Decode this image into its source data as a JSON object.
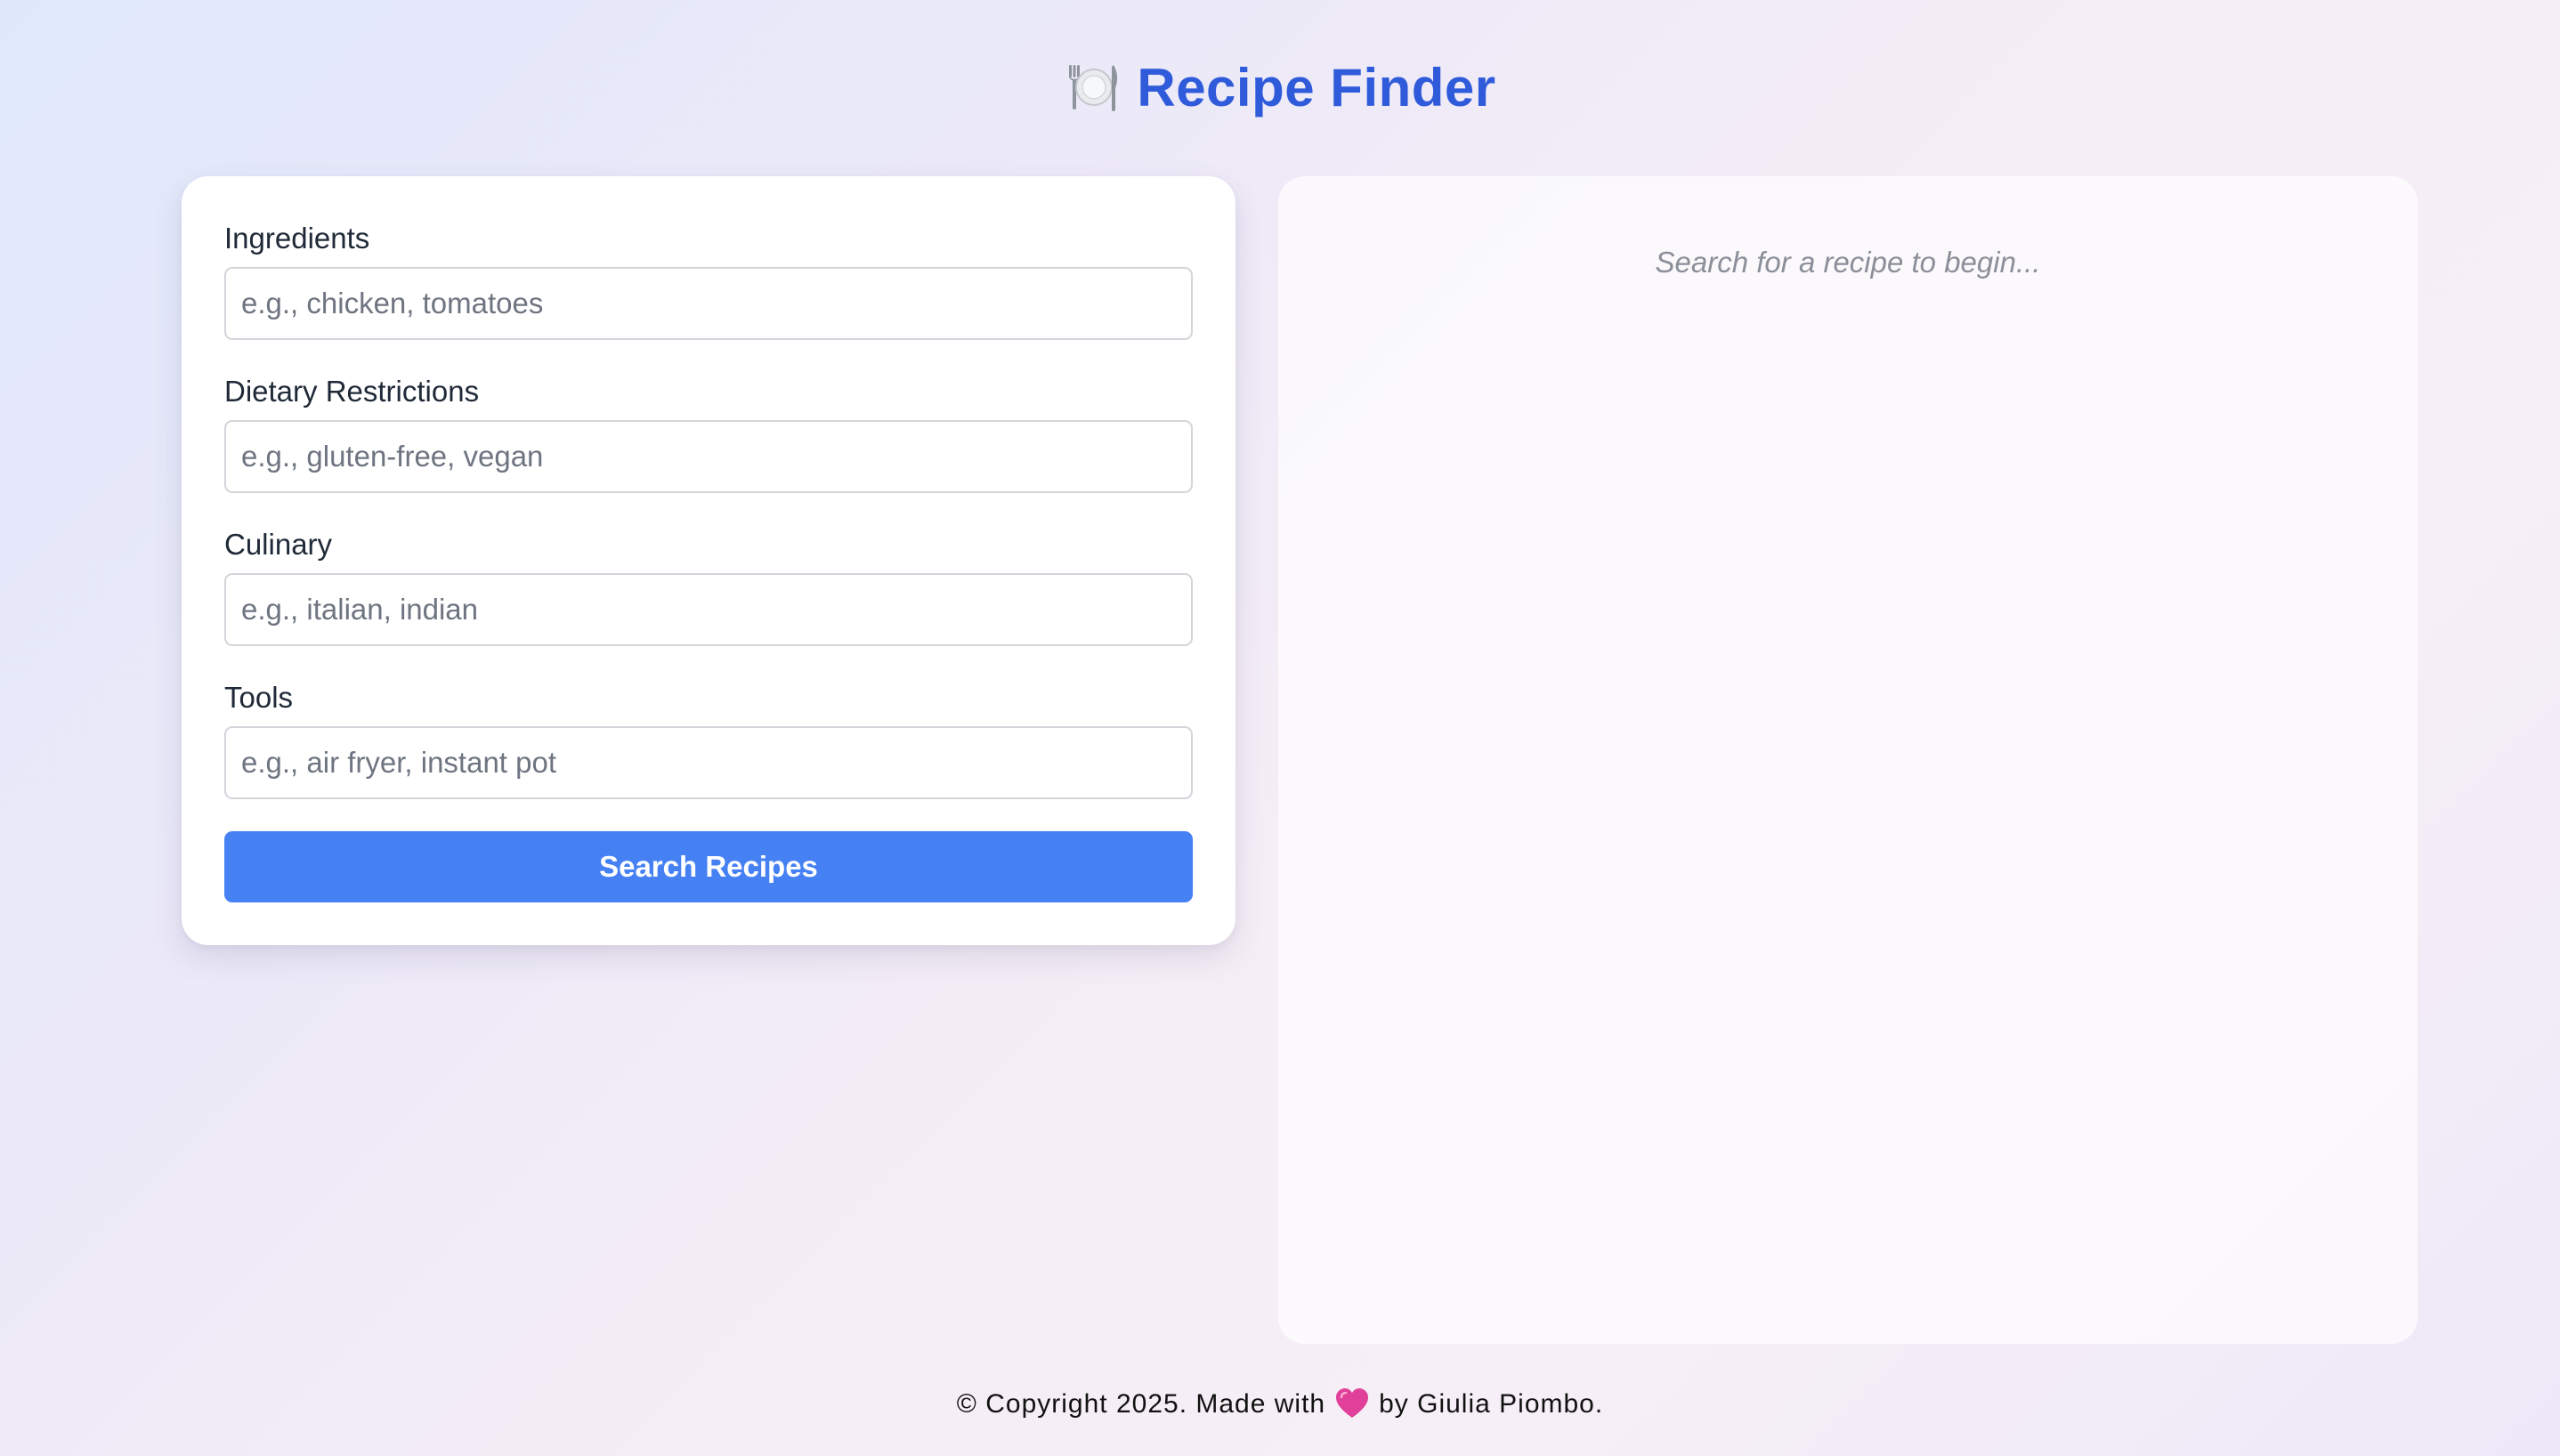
{
  "header": {
    "icon": "plate-with-cutlery-icon",
    "title": "Recipe Finder"
  },
  "form": {
    "fields": [
      {
        "label": "Ingredients",
        "placeholder": "e.g., chicken, tomatoes",
        "value": ""
      },
      {
        "label": "Dietary Restrictions",
        "placeholder": "e.g., gluten-free, vegan",
        "value": ""
      },
      {
        "label": "Culinary",
        "placeholder": "e.g., italian, indian",
        "value": ""
      },
      {
        "label": "Tools",
        "placeholder": "e.g., air fryer, instant pot",
        "value": ""
      }
    ],
    "submit_label": "Search Recipes"
  },
  "results": {
    "empty_message": "Search for a recipe to begin..."
  },
  "footer": {
    "text_before": "© Copyright 2025. Made with",
    "icon": "heart-icon",
    "text_after": "by Giulia Piombo."
  },
  "colors": {
    "accent": "#4681f4",
    "title": "#2f5bdb",
    "heart": "#e0409a"
  }
}
